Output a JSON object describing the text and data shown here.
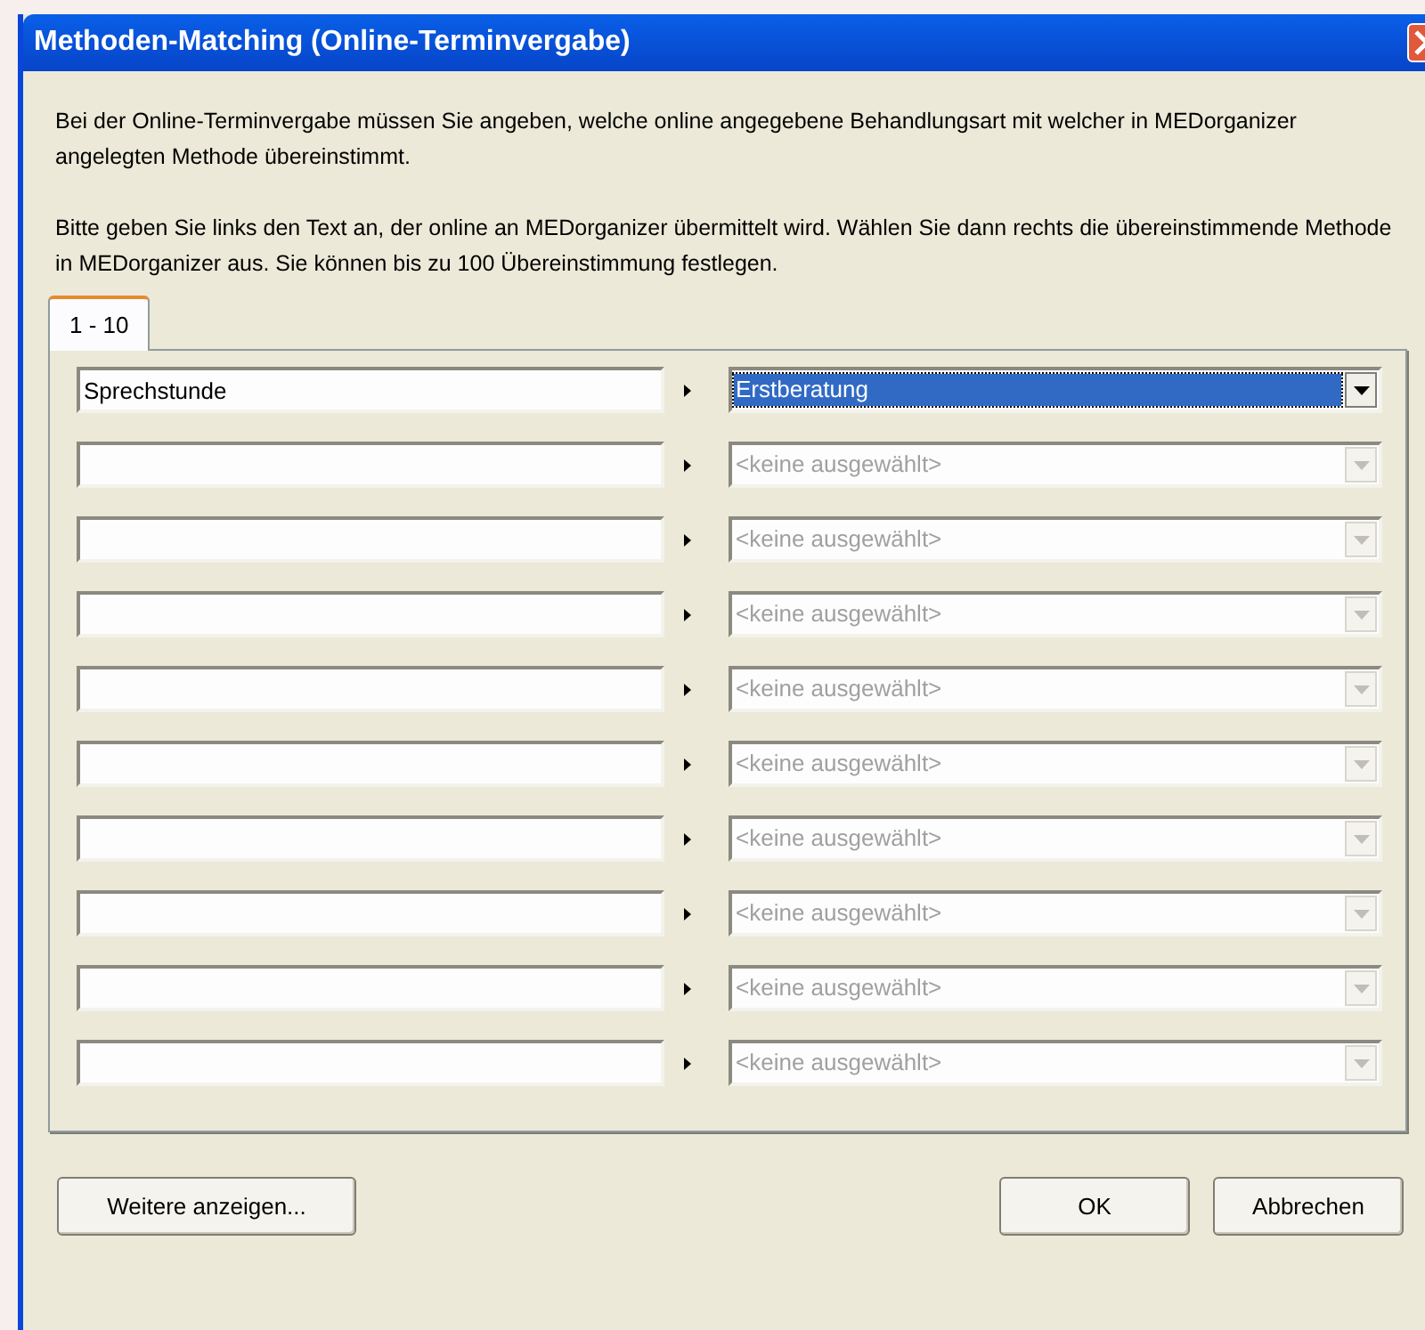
{
  "window": {
    "title": "Methoden-Matching (Online-Terminvergabe)"
  },
  "intro": [
    "Bei der Online-Terminvergabe müssen Sie angeben, welche online angegebene Behandlungsart mit welcher in MEDorganizer angelegten Methode übereinstimmt.",
    "Bitte geben Sie links den Text an, der online an MEDorganizer übermittelt wird. Wählen Sie dann rechts die übereinstimmende Methode in MEDorganizer aus. Sie können bis zu 100 Übereinstimmung festlegen."
  ],
  "tabs": [
    {
      "label": "1 - 10",
      "selected": true
    }
  ],
  "rows": [
    {
      "text": "Sprechstunde",
      "method": "Erstberatung",
      "disabled": false,
      "focused": true
    },
    {
      "text": "",
      "method": "<keine ausgewählt>",
      "disabled": true,
      "focused": false
    },
    {
      "text": "",
      "method": "<keine ausgewählt>",
      "disabled": true,
      "focused": false
    },
    {
      "text": "",
      "method": "<keine ausgewählt>",
      "disabled": true,
      "focused": false
    },
    {
      "text": "",
      "method": "<keine ausgewählt>",
      "disabled": true,
      "focused": false
    },
    {
      "text": "",
      "method": "<keine ausgewählt>",
      "disabled": true,
      "focused": false
    },
    {
      "text": "",
      "method": "<keine ausgewählt>",
      "disabled": true,
      "focused": false
    },
    {
      "text": "",
      "method": "<keine ausgewählt>",
      "disabled": true,
      "focused": false
    },
    {
      "text": "",
      "method": "<keine ausgewählt>",
      "disabled": true,
      "focused": false
    },
    {
      "text": "",
      "method": "<keine ausgewählt>",
      "disabled": true,
      "focused": false
    }
  ],
  "buttons": {
    "more": "Weitere anzeigen...",
    "ok": "OK",
    "cancel": "Abbrechen"
  }
}
